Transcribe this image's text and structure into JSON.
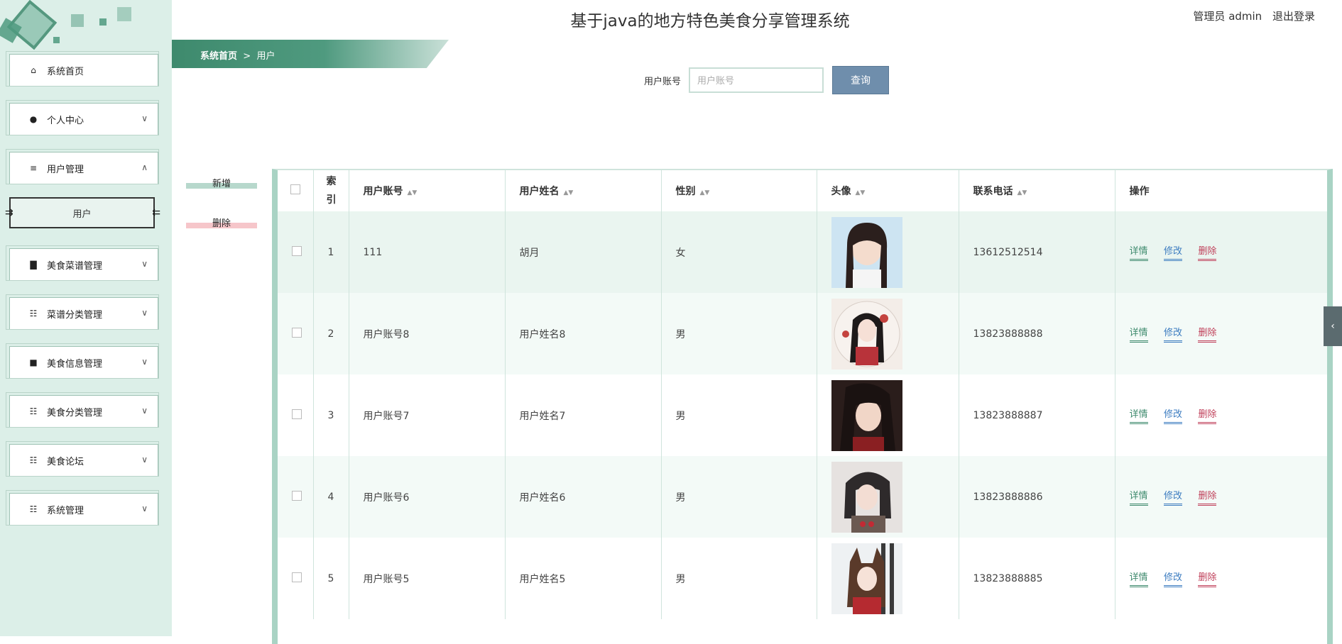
{
  "app": {
    "title": "基于java的地方特色美食分享管理系统",
    "user_label": "管理员 admin",
    "logout": "退出登录"
  },
  "sidebar": {
    "items": [
      {
        "label": "系统首页",
        "icon": "home-icon"
      },
      {
        "label": "个人中心",
        "icon": "person-icon"
      },
      {
        "label": "用户管理",
        "icon": "list-icon"
      },
      {
        "label": "美食菜谱管理",
        "icon": "bar-chart-icon"
      },
      {
        "label": "菜谱分类管理",
        "icon": "grid-icon"
      },
      {
        "label": "美食信息管理",
        "icon": "monitor-icon"
      },
      {
        "label": "美食分类管理",
        "icon": "grid-icon"
      },
      {
        "label": "美食论坛",
        "icon": "grid-icon"
      },
      {
        "label": "系统管理",
        "icon": "grid-icon"
      }
    ],
    "sub_item": "用户"
  },
  "breadcrumb": {
    "home": "系统首页",
    "separator": ">",
    "current": "用户"
  },
  "search": {
    "label": "用户账号",
    "placeholder": "用户账号",
    "value": "",
    "button": "查询"
  },
  "actions": {
    "add": "新增",
    "delete": "删除"
  },
  "table": {
    "headers": [
      "索引",
      "用户账号",
      "用户姓名",
      "性别",
      "头像",
      "联系电话",
      "操作"
    ],
    "rows": [
      {
        "index": "1",
        "account": "111",
        "name": "胡月",
        "gender": "女",
        "phone": "13612512514"
      },
      {
        "index": "2",
        "account": "用户账号8",
        "name": "用户姓名8",
        "gender": "男",
        "phone": "13823888888"
      },
      {
        "index": "3",
        "account": "用户账号7",
        "name": "用户姓名7",
        "gender": "男",
        "phone": "13823888887"
      },
      {
        "index": "4",
        "account": "用户账号6",
        "name": "用户姓名6",
        "gender": "男",
        "phone": "13823888886"
      },
      {
        "index": "5",
        "account": "用户账号5",
        "name": "用户姓名5",
        "gender": "男",
        "phone": "13823888885"
      }
    ],
    "ops": {
      "detail": "详情",
      "edit": "修改",
      "delete": "删除"
    }
  },
  "colors": {
    "accent": "#4f9a7f",
    "sidebar_bg": "#dcefe8",
    "query_button": "#6f8eac",
    "delete_red": "#c0405a",
    "edit_blue": "#3c7cc0"
  }
}
